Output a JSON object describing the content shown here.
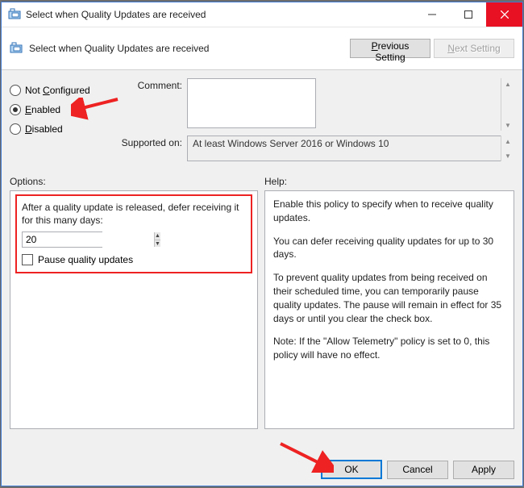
{
  "window": {
    "title": "Select when Quality Updates are received"
  },
  "header": {
    "title": "Select when Quality Updates are received",
    "prev_btn": "Previous Setting",
    "next_btn": "Next Setting"
  },
  "state": {
    "not_configured_label_pre": "Not ",
    "not_configured_label_u": "C",
    "not_configured_label_post": "onfigured",
    "enabled_u": "E",
    "enabled_post": "nabled",
    "disabled_u": "D",
    "disabled_post": "isabled"
  },
  "fields": {
    "comment_label": "Comment:",
    "comment_value": "",
    "supported_label": "Supported on:",
    "supported_value": "At least Windows Server 2016 or Windows 10"
  },
  "sections": {
    "options_label": "Options:",
    "help_label": "Help:"
  },
  "options": {
    "defer_text": "After a quality update is released, defer receiving it for this many days:",
    "defer_value": "20",
    "pause_label": "Pause quality updates"
  },
  "help": {
    "p1": "Enable this policy to specify when to receive quality updates.",
    "p2": "You can defer receiving quality updates for up to 30 days.",
    "p3": "To prevent quality updates from being received on their scheduled time, you can temporarily pause quality updates. The pause will remain in effect for 35 days or until you clear the check box.",
    "p4": "Note: If the \"Allow Telemetry\" policy is set to 0, this policy will have no effect."
  },
  "footer": {
    "ok": "OK",
    "cancel": "Cancel",
    "apply": "Apply"
  }
}
